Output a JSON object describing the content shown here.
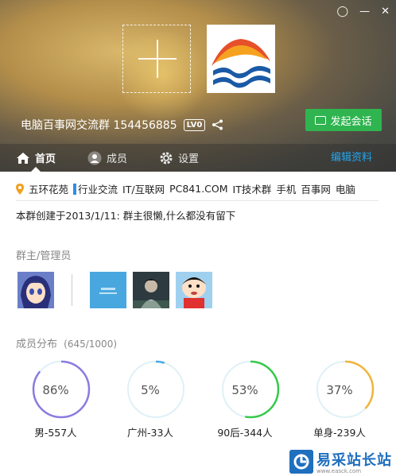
{
  "header": {
    "group_name": "电脑百事网交流群 154456885",
    "level_badge": "LV0",
    "start_chat_label": "发起会话"
  },
  "tabs": {
    "home": "首页",
    "members": "成员",
    "settings": "设置",
    "edit": "编辑资料"
  },
  "tags": {
    "location": "五环花苑",
    "industry": "行业交流",
    "category": "IT/互联网",
    "keywords": [
      "PC841.COM",
      "IT技术群",
      "手机",
      "百事网",
      "电脑"
    ]
  },
  "description": "本群创建于2013/1/11: 群主很懒,什么都没有留下",
  "admins": {
    "title": "群主/管理员"
  },
  "distribution": {
    "title": "成员分布",
    "count": "(645/1000)",
    "items": [
      {
        "percent": "86%",
        "value": 86,
        "caption": "男-557人",
        "color": "#8a7be0"
      },
      {
        "percent": "5%",
        "value": 5,
        "caption": "广州-33人",
        "color": "#4aa8e8"
      },
      {
        "percent": "53%",
        "value": 53,
        "caption": "90后-344人",
        "color": "#35c94a"
      },
      {
        "percent": "37%",
        "value": 37,
        "caption": "单身-239人",
        "color": "#f0b43c"
      }
    ]
  },
  "watermark": {
    "text": "易采站长站",
    "sub": "www.easck.com"
  }
}
